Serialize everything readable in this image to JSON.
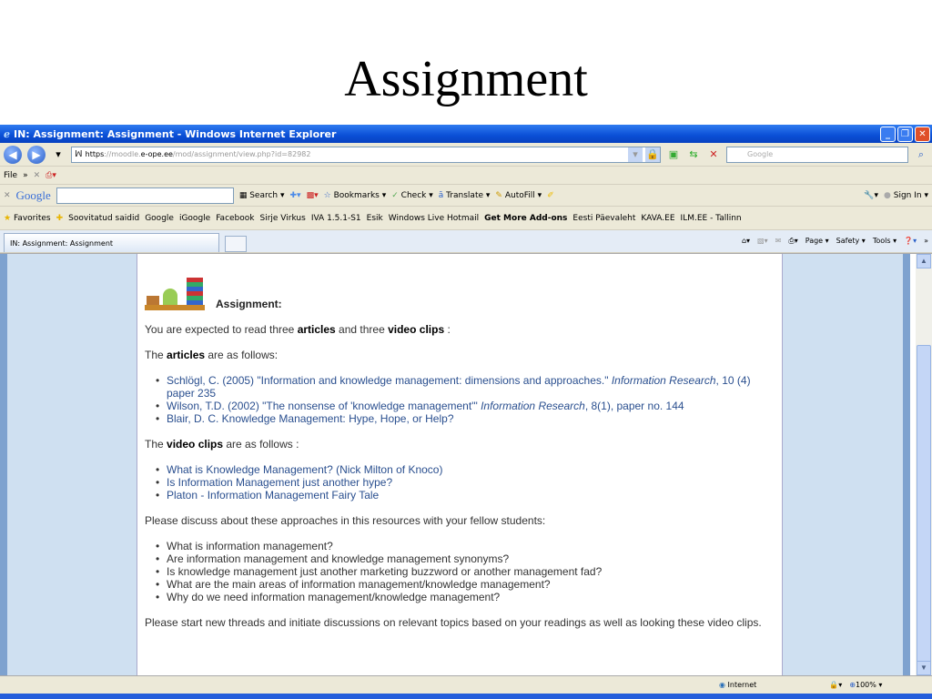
{
  "slide": {
    "title": "Assignment"
  },
  "window": {
    "title": "IN: Assignment: Assignment - Windows Internet Explorer"
  },
  "address": {
    "scheme": "https",
    "url_rest": "://moodle.",
    "domain": "e-ope.ee",
    "path": "/mod/assignment/view.php?id=82982",
    "search_placeholder": "Google"
  },
  "menu": {
    "file": "File",
    "chevron": "»"
  },
  "googlebar": {
    "logo": "Google",
    "search": "Search",
    "bookmarks": "Bookmarks",
    "check": "Check",
    "translate": "Translate",
    "autofill": "AutoFill",
    "signin": "Sign In"
  },
  "favorites": {
    "label": "Favorites",
    "items": [
      "Soovitatud saidid",
      "Google",
      "iGoogle",
      "Facebook",
      "Sirje Virkus",
      "IVA 1.5.1-S1",
      "Esik",
      "Windows Live Hotmail",
      "Get More Add-ons",
      "Eesti Päevaleht",
      "KAVA.EE",
      "ILM.EE - Tallinn"
    ]
  },
  "tab": {
    "label": "IN: Assignment: Assignment",
    "page": "Page",
    "safety": "Safety",
    "tools": "Tools"
  },
  "content": {
    "heading": "Assignment:",
    "intro": {
      "a": "You are expected to read three ",
      "b": "articles",
      "c": " and three ",
      "d": "video clips",
      "e": " :"
    },
    "articles_intro": {
      "a": "The ",
      "b": "articles",
      "c": " are as follows:"
    },
    "articles": [
      {
        "pre": "Schlögl, C. (2005) \"Information and knowledge management: dimensions and approaches.\" ",
        "journal": "Information Research",
        "post": ", 10 (4) paper 235"
      },
      {
        "pre": "Wilson, T.D. (2002) \"The nonsense of 'knowledge management'\" ",
        "journal": "Information Research",
        "post": ", 8(1), paper no. 144"
      },
      {
        "pre": "Blair, D. C. Knowledge Management: Hype, Hope, or Help?",
        "journal": "",
        "post": ""
      }
    ],
    "videos_intro": {
      "a": "The ",
      "b": "video clips",
      "c": " are as follows :"
    },
    "videos": [
      "What is Knowledge Management? (Nick Milton of Knoco)",
      "Is Information Management just another hype?",
      "Platon - Information Management Fairy Tale"
    ],
    "discuss_intro": "Please discuss about these approaches in this resources with your fellow students:",
    "questions": [
      "What is information management?",
      "Are information management and knowledge management synonyms?",
      "Is knowledge management just another marketing buzzword or another management fad?",
      "What are the main areas of information management/knowledge management?",
      "Why do we need information management/knowledge management?"
    ],
    "closing": "Please start new threads and initiate discussions on relevant topics based on your readings as well as looking these video clips."
  },
  "status": {
    "zone": "Internet",
    "zoom": "100%"
  }
}
